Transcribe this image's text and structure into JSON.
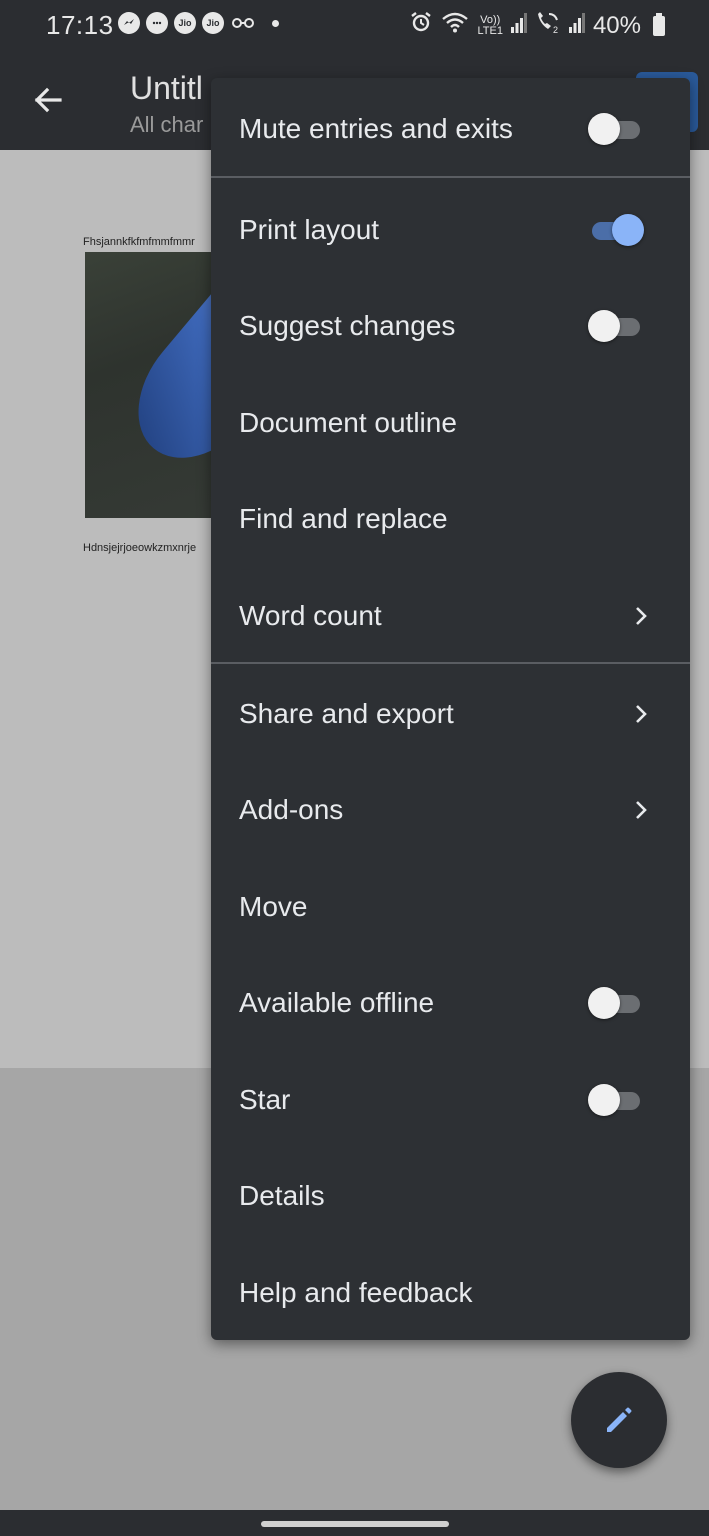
{
  "status_bar": {
    "time": "17:13",
    "left_icons": [
      "messenger-icon",
      "messages-icon",
      "jio-icon",
      "jio-icon",
      "glasses-icon",
      "dot-icon"
    ],
    "jio_label": "Jio",
    "right_icons": [
      "alarm-icon",
      "wifi-icon",
      "volte-icon",
      "signal-icon",
      "wifi-calling-icon",
      "signal-icon",
      "battery-icon"
    ],
    "volte_line1": "Vo))",
    "volte_line2": "LTE1",
    "battery": "40%"
  },
  "app_bar": {
    "title": "Untitl",
    "subtitle": "All char"
  },
  "document": {
    "line1": "Fhsjannkfkfmfmmfmmr",
    "line2": "Hdnsjejrjoeowkzmxnrje"
  },
  "menu": {
    "items": [
      {
        "label": "Mute entries and exits",
        "control": "toggle",
        "on": false
      },
      {
        "label": "Print layout",
        "control": "toggle",
        "on": true
      },
      {
        "label": "Suggest changes",
        "control": "toggle",
        "on": false
      },
      {
        "label": "Document outline",
        "control": "none"
      },
      {
        "label": "Find and replace",
        "control": "none"
      },
      {
        "label": "Word count",
        "control": "chevron"
      },
      {
        "label": "Share and export",
        "control": "chevron"
      },
      {
        "label": "Add-ons",
        "control": "chevron"
      },
      {
        "label": "Move",
        "control": "none"
      },
      {
        "label": "Available offline",
        "control": "toggle",
        "on": false
      },
      {
        "label": "Star",
        "control": "toggle",
        "on": false
      },
      {
        "label": "Details",
        "control": "none"
      },
      {
        "label": "Help and feedback",
        "control": "none"
      }
    ]
  },
  "fab": {
    "icon": "pencil-icon"
  },
  "colors": {
    "menu_bg": "#2d3034",
    "toggle_on": "#8ab4f8",
    "fab_icon": "#8ab4f8",
    "bar_bg": "#2b2d31"
  }
}
